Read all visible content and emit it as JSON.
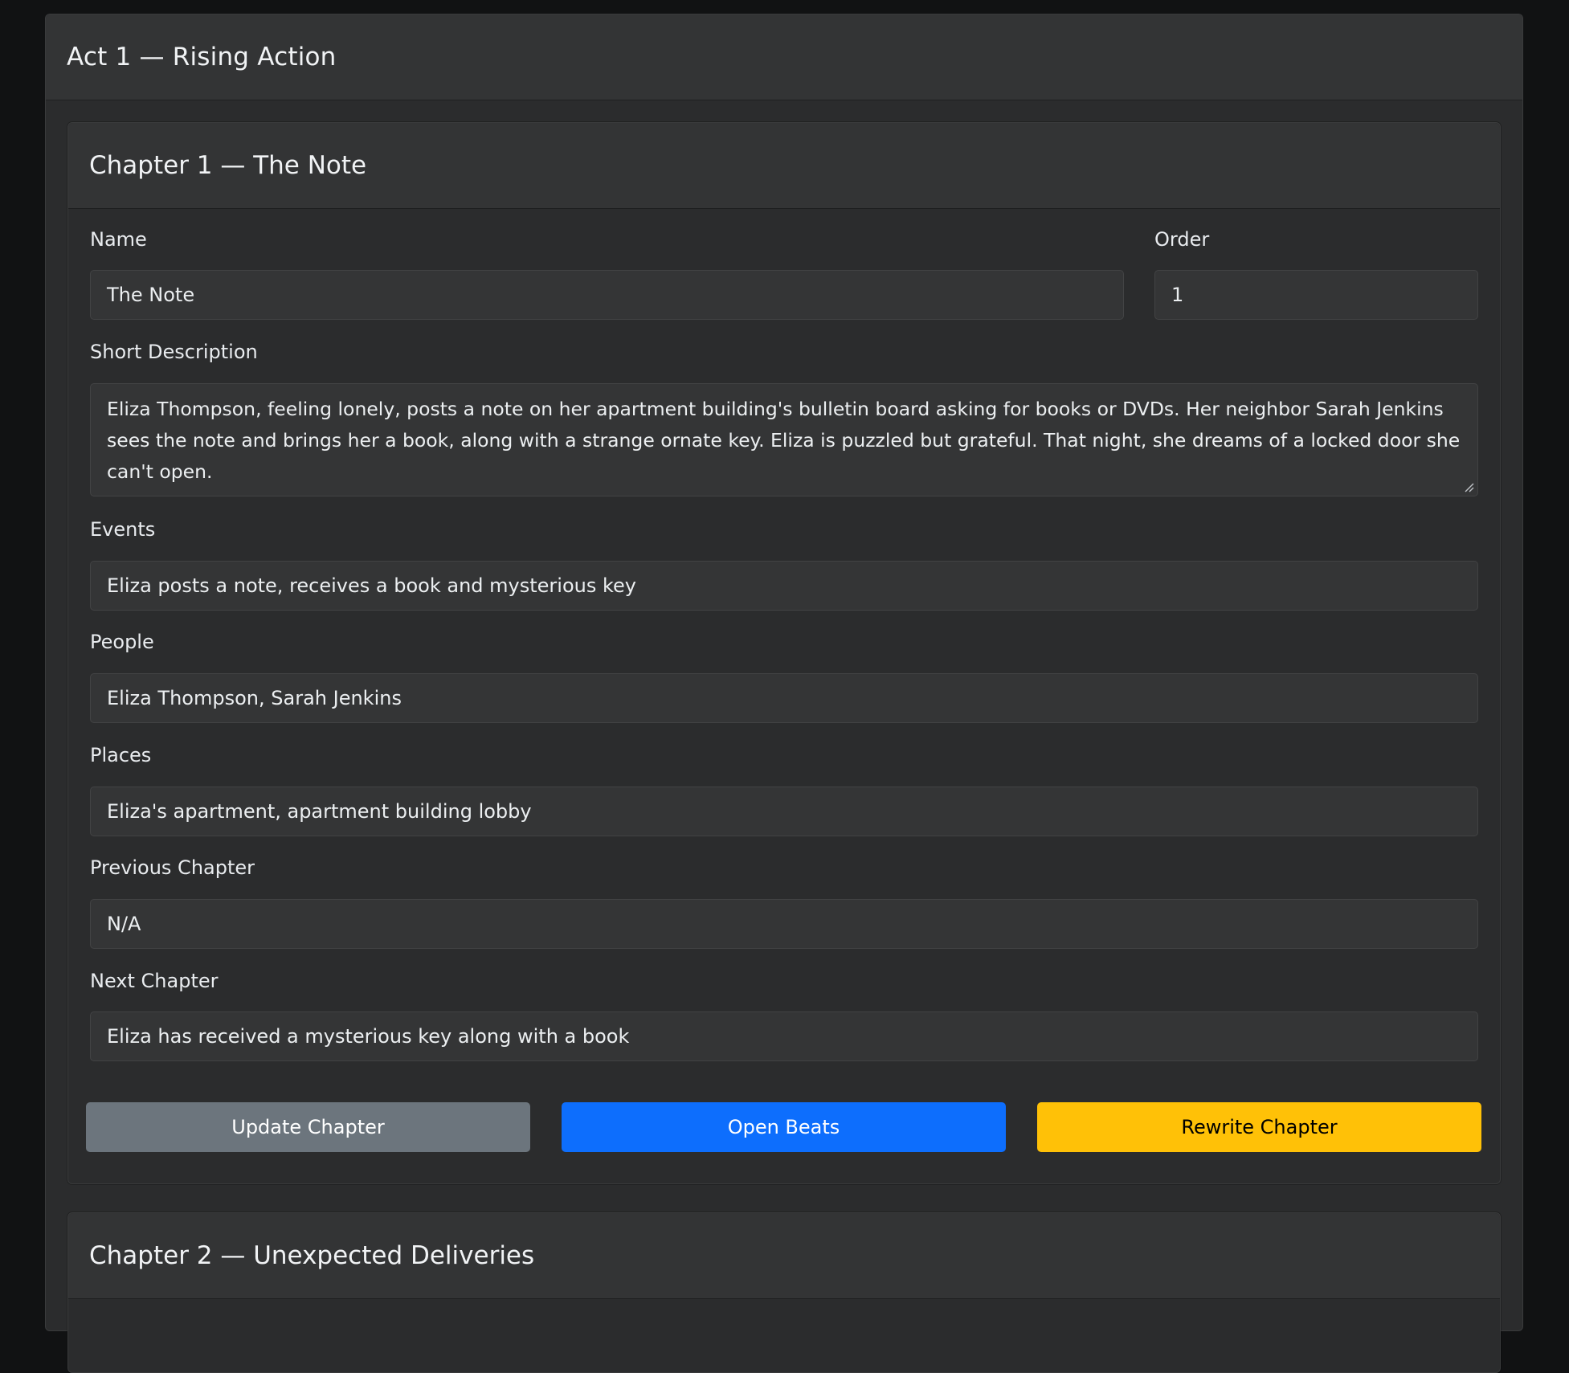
{
  "act": {
    "title": "Act 1 — Rising Action"
  },
  "chapters": [
    {
      "title": "Chapter 1 — The Note",
      "fields": {
        "name": {
          "label": "Name",
          "value": "The Note"
        },
        "order": {
          "label": "Order",
          "value": "1"
        },
        "short_description": {
          "label": "Short Description",
          "value": "Eliza Thompson, feeling lonely, posts a note on her apartment building's bulletin board asking for books or DVDs. Her neighbor Sarah Jenkins sees the note and brings her a book, along with a strange ornate key. Eliza is puzzled but grateful. That night, she dreams of a locked door she can't open."
        },
        "events": {
          "label": "Events",
          "value": "Eliza posts a note, receives a book and mysterious key"
        },
        "people": {
          "label": "People",
          "value": "Eliza Thompson, Sarah Jenkins"
        },
        "places": {
          "label": "Places",
          "value": "Eliza's apartment, apartment building lobby"
        },
        "previous_chapter": {
          "label": "Previous Chapter",
          "value": "N/A"
        },
        "next_chapter": {
          "label": "Next Chapter",
          "value": "Eliza has received a mysterious key along with a book"
        }
      },
      "buttons": {
        "update": "Update Chapter",
        "beats": "Open Beats",
        "rewrite": "Rewrite Chapter"
      }
    },
    {
      "title": "Chapter 2 — Unexpected Deliveries"
    }
  ],
  "colors": {
    "page_bg": "#111213",
    "card_bg": "#2b2c2d",
    "input_bg": "#343536",
    "secondary": "#6c757d",
    "primary": "#0d6efd",
    "warning": "#ffc107"
  }
}
